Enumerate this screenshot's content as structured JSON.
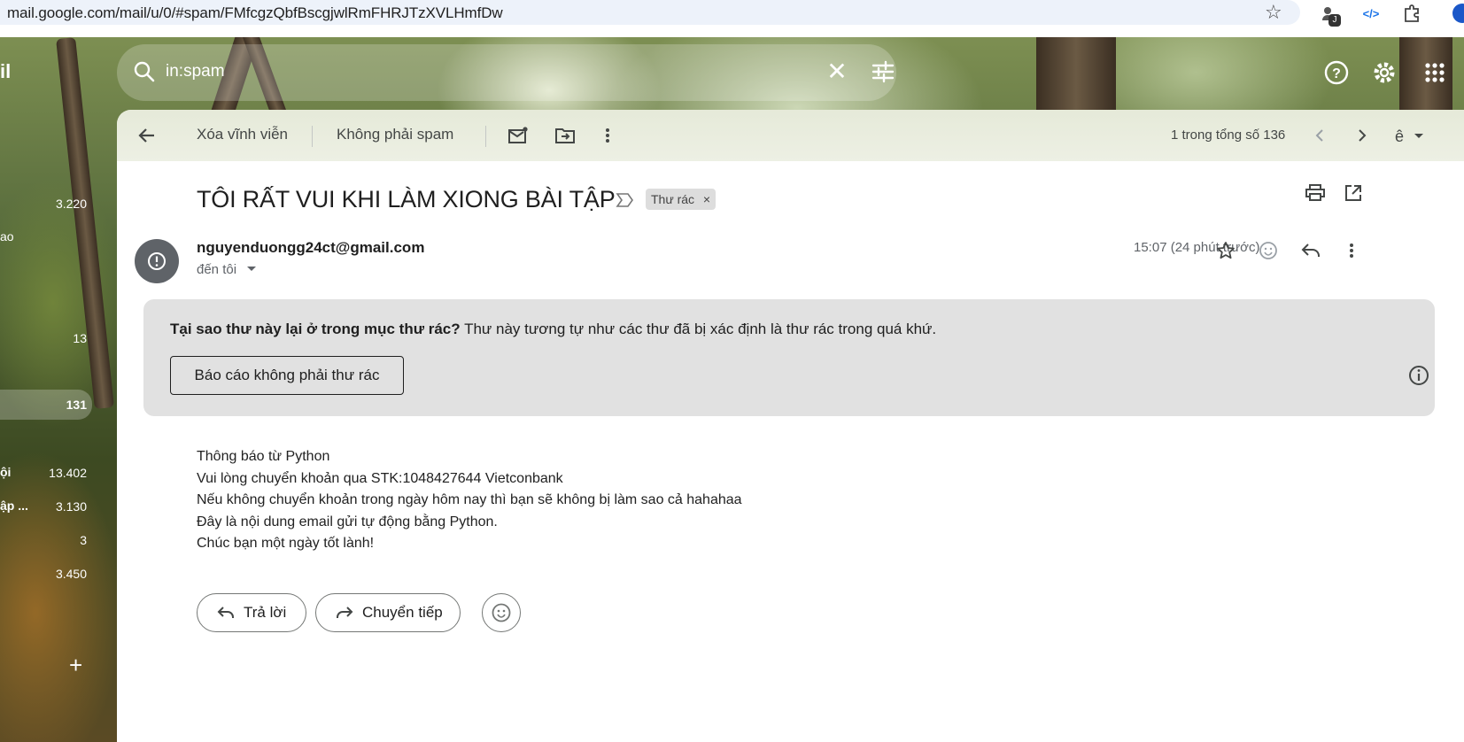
{
  "browser": {
    "url": "mail.google.com/mail/u/0/#spam/FMfcgzQbfBscgjwlRmFHRJTzXVLHmfDw",
    "ext_badge": "J",
    "ext_code": "</>"
  },
  "nav": {
    "logo_fragment": "il",
    "items": [
      {
        "label": "",
        "count": "3.220"
      },
      {
        "label": "ao",
        "count": ""
      },
      {
        "label": "",
        "count": "13"
      },
      {
        "label": "",
        "count": "131"
      },
      {
        "label": "ội",
        "count": "13.402"
      },
      {
        "label": "ập ...",
        "count": "3.130"
      },
      {
        "label": "",
        "count": "3"
      },
      {
        "label": "",
        "count": "3.450"
      }
    ],
    "plus": "+"
  },
  "search": {
    "value": "in:spam"
  },
  "toolbar": {
    "delete_forever": "Xóa vĩnh viễn",
    "not_spam": "Không phải spam",
    "count": "1 trong tổng số 136"
  },
  "email": {
    "subject": "TÔI RẤT VUI KHI LÀM XIONG BÀI TẬP",
    "label": "Thư rác",
    "sender": "nguyenduongg24ct@gmail.com",
    "to": "đến tôi",
    "time": "15:07 (24 phút trước)",
    "warning_title": "Tại sao thư này lại ở trong mục thư rác?",
    "warning_text": " Thư này tương tự như các thư đã bị xác định là thư rác trong quá khứ.",
    "report_button": "Báo cáo không phải thư rác",
    "body": [
      "Thông báo từ Python",
      "Vui lòng chuyển khoản qua STK:1048427644 Vietconbank",
      "Nếu không chuyển khoản trong ngày hôm nay thì bạn sẽ không bị làm sao cả hahahaa",
      "Đây là nội dung email gửi tự động bằng Python.",
      "Chúc bạn một ngày tốt lành!"
    ],
    "reply": "Trả lời",
    "forward": "Chuyển tiếp"
  },
  "colors": {
    "card": "#ffffff",
    "warning_bg": "#e1e1e1",
    "avatar": "#5f6368",
    "icon": "#444746"
  }
}
